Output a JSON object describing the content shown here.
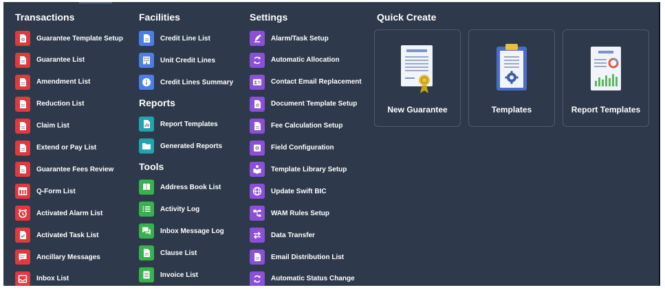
{
  "transactions": {
    "title": "Transactions",
    "items": [
      {
        "label": "Guarantee Template Setup",
        "icon": "document-gear-icon"
      },
      {
        "label": "Guarantee List",
        "icon": "document-icon"
      },
      {
        "label": "Amendment List",
        "icon": "document-icon"
      },
      {
        "label": "Reduction List",
        "icon": "document-icon"
      },
      {
        "label": "Claim List",
        "icon": "document-icon"
      },
      {
        "label": "Extend or Pay List",
        "icon": "document-icon"
      },
      {
        "label": "Guarantee Fees Review",
        "icon": "document-icon"
      },
      {
        "label": "Q-Form List",
        "icon": "table-icon"
      },
      {
        "label": "Activated Alarm List",
        "icon": "alarm-clock-icon"
      },
      {
        "label": "Activated Task List",
        "icon": "task-check-icon"
      },
      {
        "label": "Ancillary Messages",
        "icon": "message-icon"
      },
      {
        "label": "Inbox List",
        "icon": "inbox-icon"
      }
    ]
  },
  "facilities": {
    "title": "Facilities",
    "items": [
      {
        "label": "Credit Line List",
        "icon": "document-icon"
      },
      {
        "label": "Unit Credit Lines",
        "icon": "building-icon"
      },
      {
        "label": "Credit Lines Summary",
        "icon": "info-icon"
      }
    ]
  },
  "reports": {
    "title": "Reports",
    "items": [
      {
        "label": "Report Templates",
        "icon": "report-chart-icon"
      },
      {
        "label": "Generated Reports",
        "icon": "folder-icon"
      }
    ]
  },
  "tools": {
    "title": "Tools",
    "items": [
      {
        "label": "Address Book List",
        "icon": "address-book-icon"
      },
      {
        "label": "Activity Log",
        "icon": "list-icon"
      },
      {
        "label": "Inbox Message Log",
        "icon": "chat-icon"
      },
      {
        "label": "Clause List",
        "icon": "document-icon"
      },
      {
        "label": "Invoice List",
        "icon": "invoice-icon"
      }
    ]
  },
  "settings": {
    "title": "Settings",
    "items": [
      {
        "label": "Alarm/Task Setup",
        "icon": "alarm-setup-icon"
      },
      {
        "label": "Automatic Allocation",
        "icon": "sync-icon"
      },
      {
        "label": "Contact Email Replacement",
        "icon": "contact-card-icon"
      },
      {
        "label": "Document Template Setup",
        "icon": "document-gear-icon"
      },
      {
        "label": "Fee Calculation Setup",
        "icon": "document-icon"
      },
      {
        "label": "Field Configuration",
        "icon": "gear-icon"
      },
      {
        "label": "Template Library Setup",
        "icon": "library-icon"
      },
      {
        "label": "Update Swift BIC",
        "icon": "globe-icon"
      },
      {
        "label": "WAM Rules Setup",
        "icon": "hierarchy-icon"
      },
      {
        "label": "Data Transfer",
        "icon": "transfer-arrows-icon"
      },
      {
        "label": "Email Distribution List",
        "icon": "document-icon"
      },
      {
        "label": "Automatic Status Change",
        "icon": "sync-icon"
      }
    ]
  },
  "quick_create": {
    "title": "Quick Create",
    "cards": [
      {
        "label": "New Guarantee",
        "icon": "certificate-icon"
      },
      {
        "label": "Templates",
        "icon": "clipboard-gear-icon"
      },
      {
        "label": "Report Templates",
        "icon": "report-dashboard-icon"
      }
    ]
  },
  "colors": {
    "background": "#2e3a4b",
    "transactions_icon": "#e0393e",
    "facilities_icon": "#4a7fe6",
    "reports_icon": "#1ea5b0",
    "tools_icon": "#37b24d",
    "settings_icon": "#8b4fd8"
  }
}
